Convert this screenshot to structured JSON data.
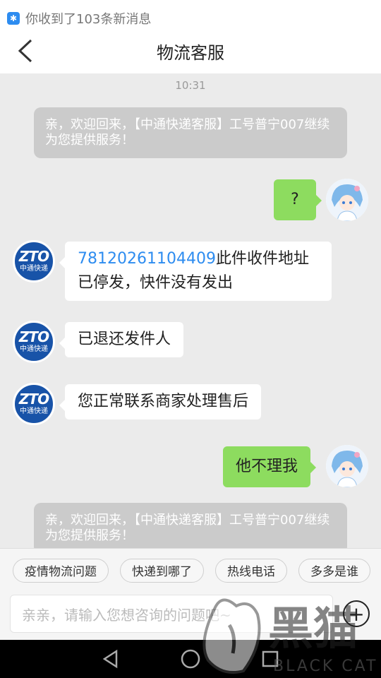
{
  "status": {
    "notification": "你收到了103条新消息"
  },
  "header": {
    "title": "物流客服"
  },
  "chat": {
    "time": "10:31",
    "system_message": "亲，欢迎回来，【中通快递客服】工号普宁007继续为您提供服务！",
    "user_msg_1": "?",
    "agent_msg_1_number": "78120261104409",
    "agent_msg_1_text": "此件收件地址已停发，快件没有发出",
    "agent_msg_2": "已退还发件人",
    "agent_msg_3": "您正常联系商家处理售后",
    "user_msg_2": "他不理我",
    "system_message_2": "亲，欢迎回来，【中通快递客服】工号普宁007继续为您提供服务！"
  },
  "zto_logo": {
    "big": "ZTO",
    "small": "中通快递"
  },
  "quick_replies": [
    "疫情物流问题",
    "快递到哪了",
    "热线电话",
    "多多是谁"
  ],
  "input": {
    "placeholder": "亲亲，请输入您想咨询的问题吧~"
  },
  "watermark": {
    "main": "黑猫",
    "sub": "BLACK CAT"
  },
  "icons": [
    "back-icon",
    "notification-icon",
    "plus-icon",
    "nav-back-icon",
    "nav-home-icon",
    "nav-recent-icon"
  ]
}
